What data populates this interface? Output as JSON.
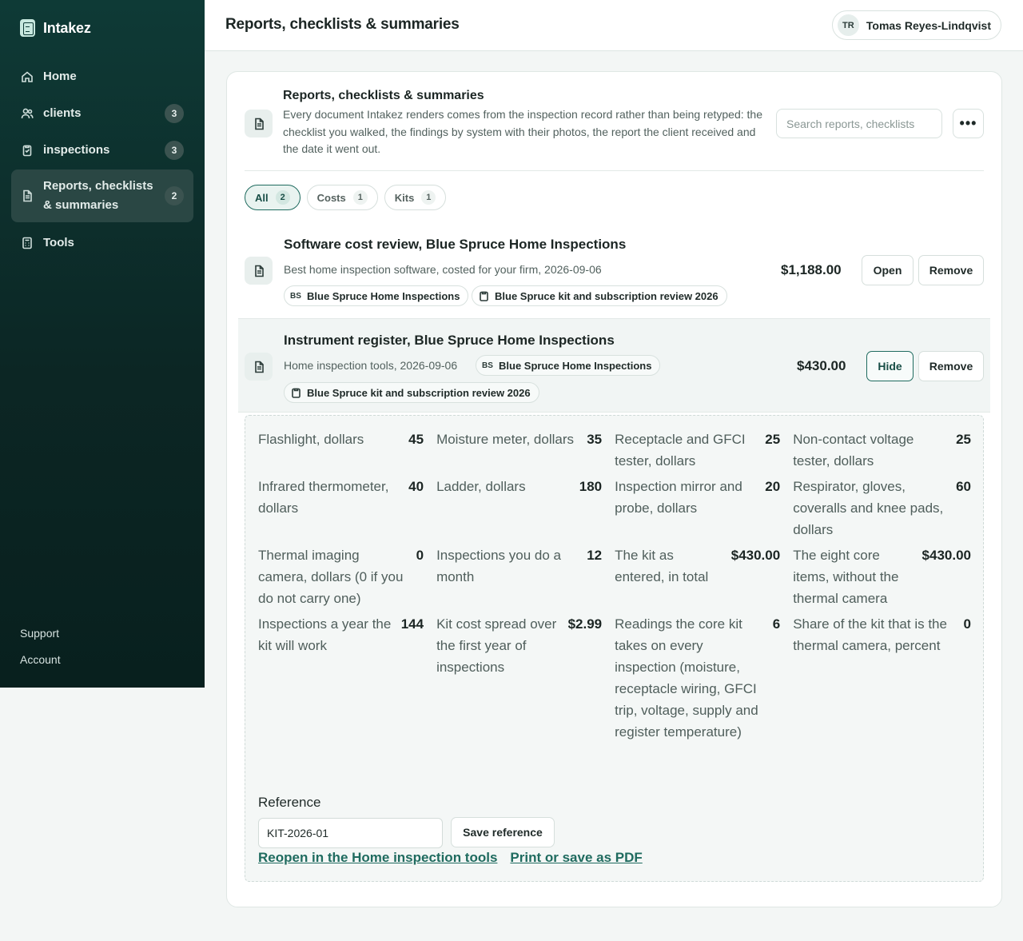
{
  "brand": {
    "name": "Intakez"
  },
  "sidebar": {
    "items": [
      {
        "label": "Home",
        "icon": "home-icon"
      },
      {
        "label": "clients",
        "badge": "3",
        "icon": "users-icon"
      },
      {
        "label": "inspections",
        "badge": "3",
        "icon": "clipboard-icon"
      },
      {
        "label": "Reports, checklists & summaries",
        "badge": "2",
        "icon": "document-icon",
        "active": true
      },
      {
        "label": "Tools",
        "icon": "calculator-icon"
      }
    ],
    "footer": {
      "support": "Support",
      "account": "Account"
    }
  },
  "header": {
    "title": "Reports, checklists & summaries",
    "user": {
      "initials": "TR",
      "name": "Tomas Reyes-Lindqvist"
    }
  },
  "section": {
    "title": "Reports, checklists & summaries",
    "description": "Every document Intakez renders comes from the inspection record rather than being retyped: the checklist you walked, the findings by system with their photos, the report the client received and the date it went out.",
    "search_placeholder": "Search reports, checklists",
    "more_label": "•••"
  },
  "filters": [
    {
      "label": "All",
      "count": "2",
      "active": true
    },
    {
      "label": "Costs",
      "count": "1"
    },
    {
      "label": "Kits",
      "count": "1"
    }
  ],
  "rows": [
    {
      "title": "Software cost review, Blue Spruce Home Inspections",
      "subtitle": "Best home inspection software, costed for your firm, 2026-09-06",
      "client_tag": {
        "initials": "BS",
        "label": "Blue Spruce Home Inspections"
      },
      "inspection_tag": "Blue Spruce kit and subscription review 2026",
      "amount": "$1,188.00",
      "primary_button": "Open",
      "remove_button": "Remove"
    },
    {
      "title": "Instrument register, Blue Spruce Home Inspections",
      "subtitle": "Home inspection tools, 2026-09-06",
      "client_tag": {
        "initials": "BS",
        "label": "Blue Spruce Home Inspections"
      },
      "inspection_tag": "Blue Spruce kit and subscription review 2026",
      "amount": "$430.00",
      "primary_button": "Hide",
      "remove_button": "Remove"
    }
  ],
  "detail": {
    "metrics": [
      [
        {
          "label": "Flashlight, dollars",
          "value": "45"
        },
        {
          "label": "Moisture meter, dollars",
          "value": "35"
        },
        {
          "label": "Receptacle and GFCI tester, dollars",
          "value": "25"
        },
        {
          "label": "Non-contact voltage tester, dollars",
          "value": "25"
        }
      ],
      [
        {
          "label": "Infrared thermometer, dollars",
          "value": "40"
        },
        {
          "label": "Ladder, dollars",
          "value": "180"
        },
        {
          "label": "Inspection mirror and probe, dollars",
          "value": "20"
        },
        {
          "label": "Respirator, gloves, coveralls and knee pads, dollars",
          "value": "60"
        }
      ],
      [
        {
          "label": "Thermal imaging camera, dollars (0 if you do not carry one)",
          "value": "0"
        },
        {
          "label": "Inspections you do a month",
          "value": "12"
        },
        {
          "label": "The kit as entered, in total",
          "value": "$430.00"
        },
        {
          "label": "The eight core items, without the thermal camera",
          "value": "$430.00"
        }
      ],
      [
        {
          "label": "Inspections a year the kit will work",
          "value": "144"
        },
        {
          "label": "Kit cost spread over the first year of inspections",
          "value": "$2.99"
        },
        {
          "label": "Readings the core kit takes on every inspection (moisture, receptacle wiring, GFCI trip, voltage, supply and register temperature)",
          "value": "6"
        },
        {
          "label": "Share of the kit that is the thermal camera, percent",
          "value": "0"
        }
      ]
    ],
    "reference_label": "Reference",
    "reference_value": "KIT-2026-01",
    "save_reference": "Save reference",
    "reopen_link": "Reopen in the Home inspection tools",
    "print_link": "Print or save as PDF"
  }
}
